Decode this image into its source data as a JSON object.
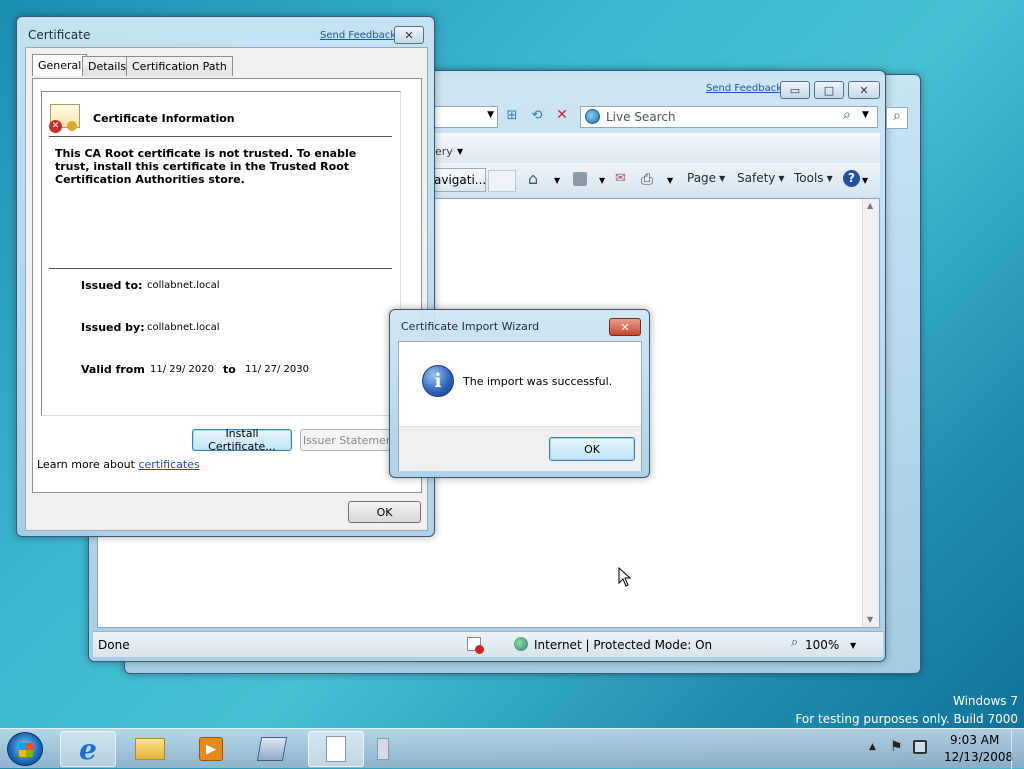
{
  "ie_window": {
    "send_feedback": "Send Feedback",
    "search_placeholder": "Live Search",
    "gallery_partial": "ery",
    "tab_partial": "avigati...",
    "toolbar": {
      "page": "Page",
      "safety": "Safety",
      "tools": "Tools"
    },
    "status": {
      "done": "Done",
      "zone": "Internet | Protected Mode: On",
      "zoom": "100%"
    }
  },
  "cert_dialog": {
    "title": "Certificate",
    "send_feedback": "Send Feedback",
    "tabs": [
      "General",
      "Details",
      "Certification Path"
    ],
    "info_title": "Certificate Information",
    "warning": "This CA Root certificate is not trusted. To enable trust, install this certificate in the Trusted Root Certification Authorities store.",
    "issued_to_label": "Issued to:",
    "issued_to_value": "collabnet.local",
    "issued_by_label": "Issued by:",
    "issued_by_value": "collabnet.local",
    "valid_from_label": "Valid from",
    "valid_from_value": "11/ 29/ 2020",
    "to_label": "to",
    "valid_to_value": "11/ 27/ 2030",
    "install_button": "Install Certificate...",
    "issuer_button": "Issuer Statement",
    "learn_more": "Learn more about",
    "learn_more_link": "certificates",
    "ok_button": "OK"
  },
  "wizard": {
    "title": "Certificate Import Wizard",
    "message": "The import was successful.",
    "ok_button": "OK"
  },
  "desktop": {
    "watermark_line1": "Windows 7",
    "watermark_line2": "For testing purposes only. Build 7000"
  },
  "taskbar": {
    "time": "9:03 AM",
    "date": "12/13/2008"
  }
}
